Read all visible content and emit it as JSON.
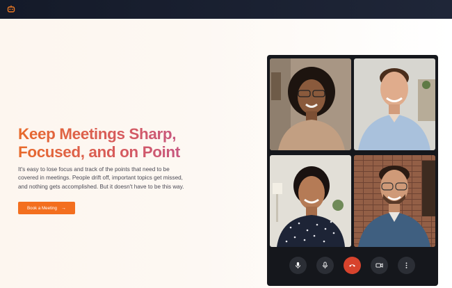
{
  "header": {
    "logo_icon": "robot-icon"
  },
  "hero": {
    "title_line1": "Keep Meetings Sharp,",
    "title_line2": "Focused, and on Point",
    "description": "It's easy to lose focus and track of the points that need to be covered in meetings. People drift off, important topics get missed, and nothing gets accomplished. But it doesn't have to be this way.",
    "cta_label": "Book a Meeting",
    "cta_icon": "arrow-right-icon",
    "title_gradient": [
      "#e86a2b",
      "#b555a6"
    ],
    "cta_color": "#f36f1f"
  },
  "call": {
    "participants": [
      {
        "id": "participant-1"
      },
      {
        "id": "participant-2"
      },
      {
        "id": "participant-3"
      },
      {
        "id": "participant-4"
      }
    ],
    "controls": [
      "microphone-icon",
      "microphone-icon",
      "end-call-icon",
      "camera-icon",
      "more-options-icon"
    ],
    "end_call_color": "#d7432d"
  }
}
